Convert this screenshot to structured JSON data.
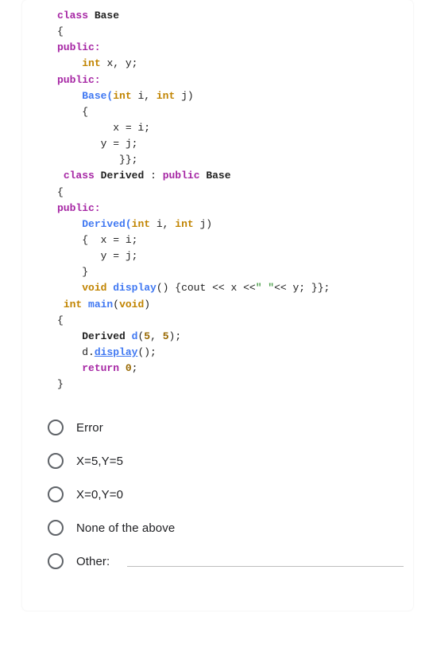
{
  "code": {
    "c1": "class",
    "c1b": "Base",
    "c2": "{",
    "c3": "public:",
    "c4a": "int",
    "c4b": "x, y;",
    "c5": "public:",
    "c6a": "Base(",
    "c6b": "int",
    "c6c": "i,",
    "c6d": "int",
    "c6e": "j)",
    "c7": "{",
    "c8": "x = i;",
    "c9": "y = j;",
    "c10": "}};",
    "c11a": "class",
    "c11b": "Derived",
    "c11c": ":",
    "c11d": "public",
    "c11e": "Base",
    "c12": "{",
    "c13": "public:",
    "c14a": "Derived(",
    "c14b": "int",
    "c14c": "i,",
    "c14d": "int",
    "c14e": "j)",
    "c15": "{  x = i;",
    "c16": "y = j;",
    "c17": "}",
    "c18a": "void",
    "c18b": "display",
    "c18c": "() {cout << x <<",
    "c18d": "\" \"",
    "c18e": "<< y; }};",
    "c19a": "int",
    "c19b": "main",
    "c19c": "(",
    "c19d": "void",
    "c19e": ")",
    "c20": "{",
    "c21a": "Derived",
    "c21b": "d",
    "c21c": "(",
    "c21d": "5",
    "c21e": ",",
    "c21f": "5",
    "c21g": ");",
    "c22": "d.",
    "c22b": "display",
    "c22c": "();",
    "c23a": "return",
    "c23b": "0",
    "c23c": ";",
    "c24": "}"
  },
  "options": {
    "o1": "Error",
    "o2": "X=5,Y=5",
    "o3": "X=0,Y=0",
    "o4": "None of the above",
    "o5": "Other:"
  }
}
